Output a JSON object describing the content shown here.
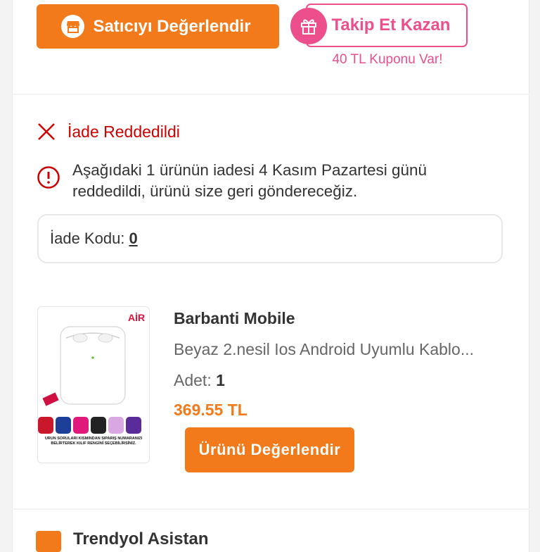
{
  "seller_actions": {
    "rate_seller_label": "Satıcıyı Değerlendir",
    "follow_label": "Takip Et Kazan",
    "coupon_text": "40 TL Kuponu Var!"
  },
  "return_status": {
    "title": "İade Reddedildi",
    "message": "Aşağıdaki 1 ürünün iadesi 4 Kasım Pazartesi günü reddedildi, ürünü size geri göndereceğiz.",
    "code_label": "İade Kodu:",
    "code_value": "0"
  },
  "product": {
    "seller": "Barbanti Mobile",
    "name": "Beyaz 2.nesil Ios Android Uyumlu Kablo...",
    "quantity_label": "Adet:",
    "quantity_value": "1",
    "price": "369.55 TL",
    "rate_button": "Ürünü Değerlendir",
    "image_badge": "AİR",
    "image_caption": "ÜRÜN SORULARI KISMINDAN SİPARİŞ NUMARANIZI BELİRTEREK KILIF RENGİNİ SEÇEBİLİRSİNİZ."
  },
  "assistant": {
    "title": "Trendyol Asistan"
  },
  "colors": {
    "brand_orange": "#f27a1a",
    "pink": "#ec4f8b",
    "error_red": "#cf0000"
  }
}
